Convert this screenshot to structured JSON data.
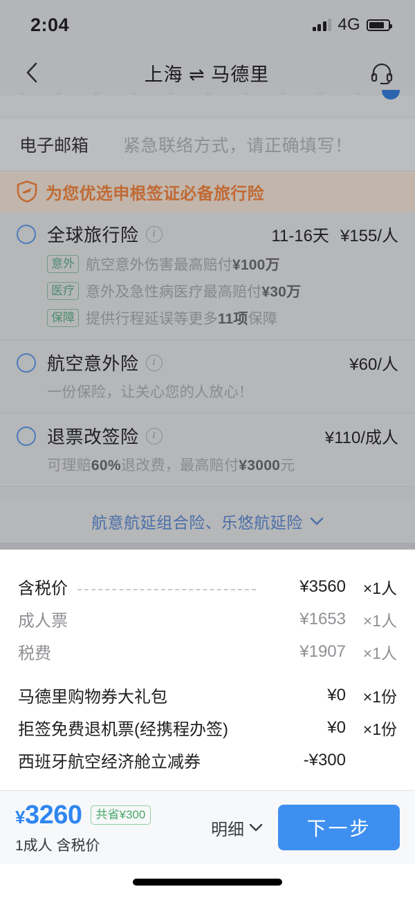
{
  "status_bar": {
    "time": "2:04",
    "network": "4G"
  },
  "nav": {
    "title": "上海 ⇌ 马德里",
    "back_icon": "chevron-left-icon",
    "service_icon": "headset-icon"
  },
  "contact": {
    "email_label": "电子邮箱",
    "email_placeholder": "紧急联络方式，请正确填写！",
    "email_value": ""
  },
  "insurance_banner": {
    "icon": "shield-plane-icon",
    "text": "为您优选申根签证必备旅行险"
  },
  "insurance": {
    "items": [
      {
        "name": "全球旅行险",
        "info_icon": "info-circle-icon",
        "duration": "11-16天",
        "price": "¥155/人",
        "selected": false,
        "features": [
          {
            "tag": "意外",
            "text_before": "航空意外伤害最高赔付",
            "highlight": "¥100万",
            "text_after": ""
          },
          {
            "tag": "医疗",
            "text_before": "意外及急性病医疗最高赔付",
            "highlight": "¥30万",
            "text_after": ""
          },
          {
            "tag": "保障",
            "text_before": "提供行程延误等更多",
            "highlight": "11项",
            "text_after": "保障"
          }
        ],
        "subtitle": null
      },
      {
        "name": "航空意外险",
        "info_icon": "info-circle-icon",
        "duration": "",
        "price": "¥60/人",
        "selected": false,
        "features": [],
        "subtitle": {
          "text_before": "一份保险，让关心您的人放心！",
          "highlight": "",
          "text_after": ""
        }
      },
      {
        "name": "退票改签险",
        "info_icon": "info-circle-icon",
        "duration": "",
        "price": "¥110/成人",
        "selected": false,
        "features": [],
        "subtitle": {
          "text_before": "可理赔",
          "highlight": "60%",
          "text_mid": "退改费，最高赔付",
          "highlight2": "¥3000",
          "text_after": "元"
        }
      }
    ],
    "more_link": "航意航延组合险、乐悠航延险",
    "more_icon": "chevron-down-icon"
  },
  "price_detail": {
    "rows": [
      {
        "label": "含税价",
        "amount": "¥3560",
        "qty": "×1人",
        "muted": false,
        "leader": true
      },
      {
        "label": "成人票",
        "amount": "¥1653",
        "qty": "×1人",
        "muted": true,
        "leader": false
      },
      {
        "label": "税费",
        "amount": "¥1907",
        "qty": "×1人",
        "muted": true,
        "leader": false
      },
      {
        "label": "马德里购物券大礼包",
        "amount": "¥0",
        "qty": "×1份",
        "muted": false,
        "leader": false
      },
      {
        "label": "拒签免费退机票(经携程办签)",
        "amount": "¥0",
        "qty": "×1份",
        "muted": false,
        "leader": false
      },
      {
        "label": "西班牙航空经济舱立减券",
        "amount": "-¥300",
        "qty": "",
        "muted": false,
        "leader": false
      }
    ]
  },
  "bottom_bar": {
    "currency": "¥",
    "total": "3260",
    "saving_badge": "共省¥300",
    "subtitle": "1成人 含税价",
    "detail_label": "明细",
    "detail_icon": "chevron-down-icon",
    "next_label": "下一步"
  },
  "colors": {
    "accent_blue": "#3e8ff0",
    "price_blue": "#2f86f0",
    "banner_orange": "#c06a35",
    "tag_green": "#4e8b6e",
    "save_green": "#4aa86a"
  }
}
